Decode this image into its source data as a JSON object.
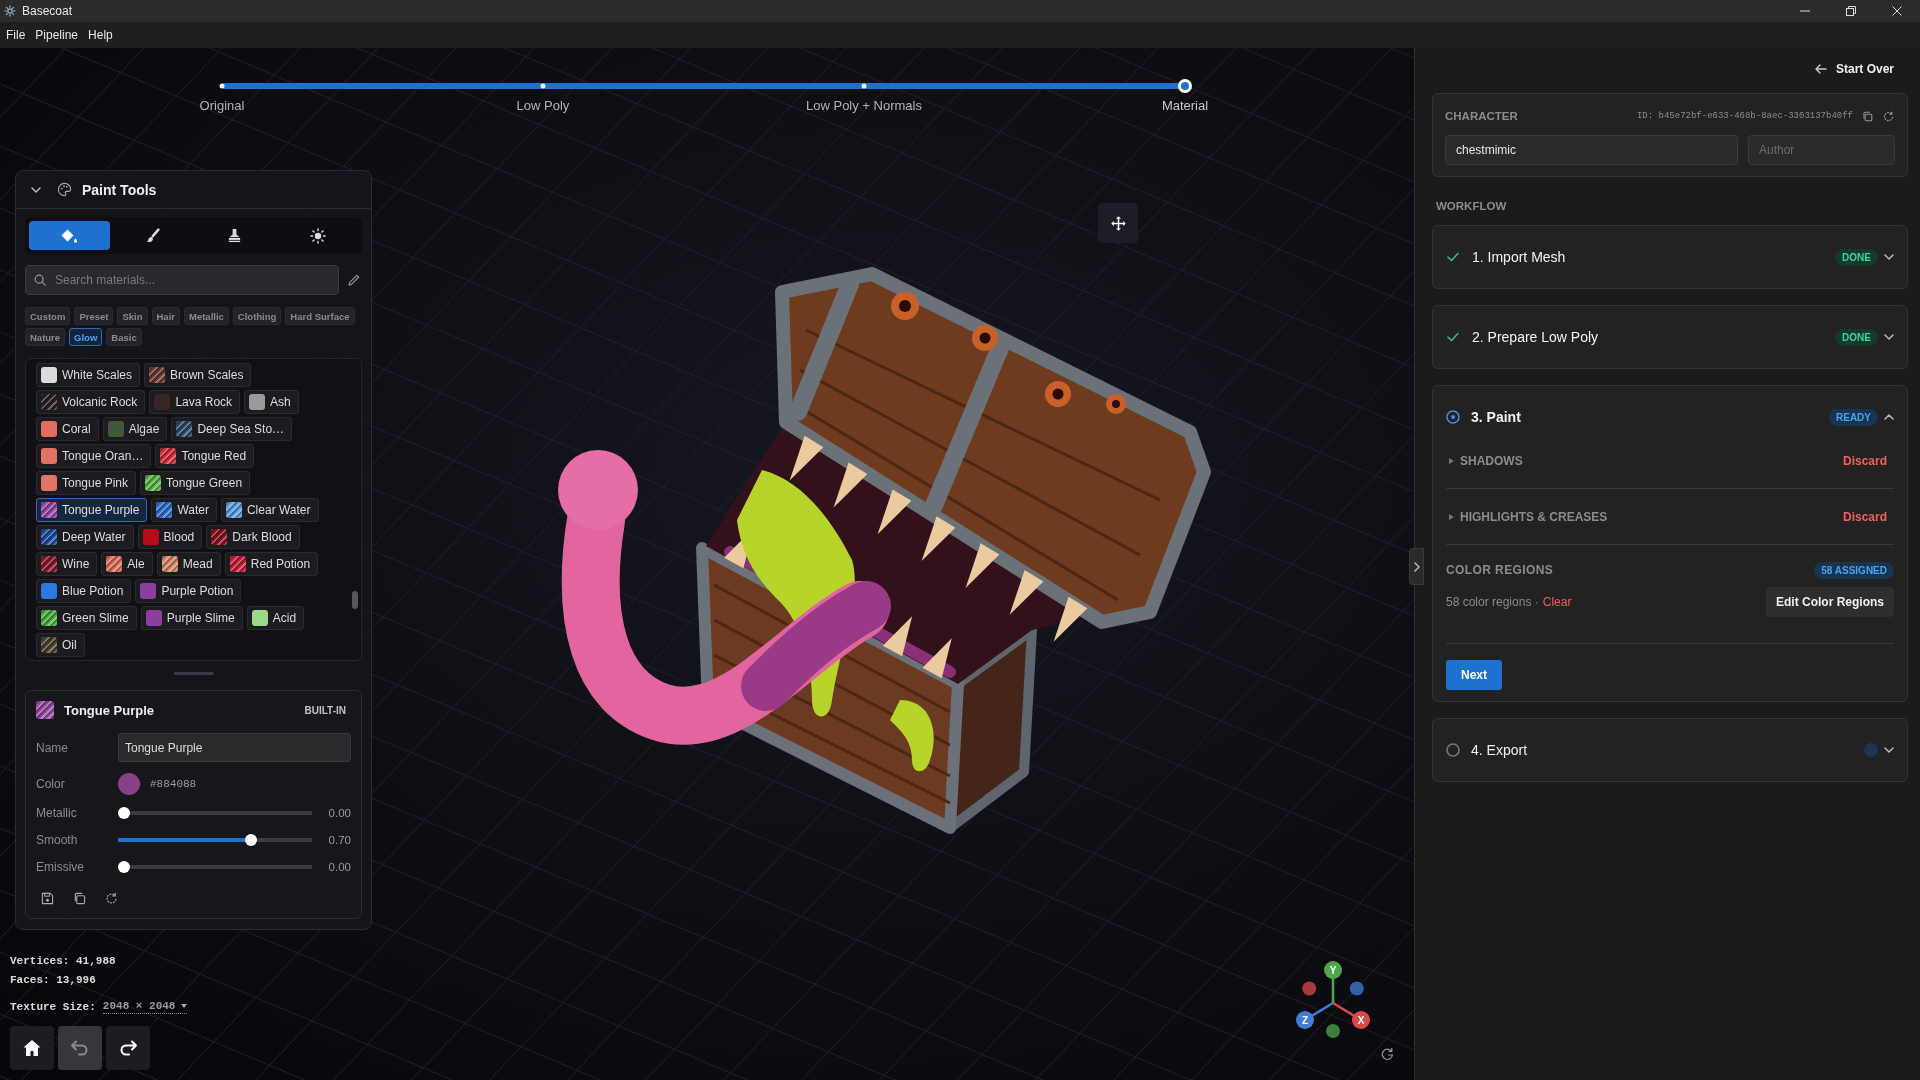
{
  "window": {
    "title": "Basecoat"
  },
  "menu": [
    "File",
    "Pipeline",
    "Help"
  ],
  "pipeline": {
    "level": 1,
    "steps": [
      {
        "label": "Original",
        "selected": false
      },
      {
        "label": "Low Poly",
        "selected": false
      },
      {
        "label": "Low Poly + Normals",
        "selected": false
      },
      {
        "label": "Material",
        "selected": true
      }
    ]
  },
  "paint_tools": {
    "title": "Paint Tools",
    "expanded": true,
    "tools": [
      {
        "kind": "fill",
        "selected": true
      },
      {
        "kind": "brush",
        "selected": false
      },
      {
        "kind": "stamp",
        "selected": false
      },
      {
        "kind": "light",
        "selected": false
      }
    ],
    "search": {
      "placeholder": "Search materials..."
    },
    "categories": [
      {
        "label": "Custom",
        "selected": false
      },
      {
        "label": "Preset",
        "selected": false
      },
      {
        "label": "Skin",
        "selected": false
      },
      {
        "label": "Hair",
        "selected": false
      },
      {
        "label": "Metallic",
        "selected": false
      },
      {
        "label": "Clothing",
        "selected": false
      },
      {
        "label": "Hard Surface",
        "selected": false
      },
      {
        "label": "Nature",
        "selected": false
      },
      {
        "label": "Glow",
        "selected": true
      },
      {
        "label": "Basic",
        "selected": false
      }
    ],
    "materials": [
      {
        "name": "White Scales",
        "color": "#dcdcdc",
        "striped": false,
        "selected": false
      },
      {
        "name": "Brown Scales",
        "color": "#6b3a35",
        "striped": true,
        "selected": false
      },
      {
        "name": "Volcanic Rock",
        "color": "#2e1f1c",
        "striped": true,
        "selected": false
      },
      {
        "name": "Lava Rock",
        "color": "#3a2420",
        "striped": false,
        "selected": false
      },
      {
        "name": "Ash",
        "color": "#9a9a9a",
        "striped": false,
        "selected": false
      },
      {
        "name": "Coral",
        "color": "#e06e62",
        "striped": false,
        "selected": false
      },
      {
        "name": "Algae",
        "color": "#3f5a3a",
        "striped": false,
        "selected": false
      },
      {
        "name": "Deep Sea Sto…",
        "color": "#2f4a6a",
        "striped": true,
        "selected": false
      },
      {
        "name": "Tongue Oran…",
        "color": "#e07262",
        "striped": false,
        "selected": false
      },
      {
        "name": "Tongue Red",
        "color": "#d0303e",
        "striped": true,
        "selected": false
      },
      {
        "name": "Tongue Pink",
        "color": "#e0756a",
        "striped": false,
        "selected": false
      },
      {
        "name": "Tongue Green",
        "color": "#5cb84b",
        "striped": true,
        "selected": false
      },
      {
        "name": "Tongue Purple",
        "color": "#9a4aa8",
        "striped": true,
        "selected": true
      },
      {
        "name": "Water",
        "color": "#2f6fd0",
        "striped": true,
        "selected": false
      },
      {
        "name": "Clear Water",
        "color": "#5aa0ea",
        "striped": true,
        "selected": false
      },
      {
        "name": "Deep Water",
        "color": "#1f4ba0",
        "striped": true,
        "selected": false
      },
      {
        "name": "Blood",
        "color": "#b50d18",
        "striped": false,
        "selected": false
      },
      {
        "name": "Dark Blood",
        "color": "#8b1020",
        "striped": true,
        "selected": false
      },
      {
        "name": "Wine",
        "color": "#8c1830",
        "striped": true,
        "selected": false
      },
      {
        "name": "Ale",
        "color": "#e0735e",
        "striped": true,
        "selected": false
      },
      {
        "name": "Mead",
        "color": "#d98a6c",
        "striped": true,
        "selected": false
      },
      {
        "name": "Red Potion",
        "color": "#c8203a",
        "striped": true,
        "selected": false
      },
      {
        "name": "Blue Potion",
        "color": "#2b79e1",
        "striped": false,
        "selected": false
      },
      {
        "name": "Purple Potion",
        "color": "#8b40a0",
        "striped": false,
        "selected": false
      },
      {
        "name": "Green Slime",
        "color": "#4fb040",
        "striped": true,
        "selected": false
      },
      {
        "name": "Purple Slime",
        "color": "#8b40a0",
        "striped": false,
        "selected": false
      },
      {
        "name": "Acid",
        "color": "#9bd88a",
        "striped": false,
        "selected": false
      },
      {
        "name": "Oil",
        "color": "#4f4232",
        "striped": true,
        "selected": false
      }
    ],
    "details": {
      "title": "Tongue Purple",
      "tag": "BUILT-IN",
      "name_label": "Name",
      "name_value": "Tongue Purple",
      "color_label": "Color",
      "color": "#884088",
      "color_text": "#884088",
      "sliders": [
        {
          "label": "Metallic",
          "level": 0,
          "reading": "0.00"
        },
        {
          "label": "Smooth",
          "level": 0.7,
          "reading": "0.70"
        },
        {
          "label": "Emissive",
          "level": 0,
          "reading": "0.00"
        }
      ]
    }
  },
  "stats": {
    "vertices": "Vertices: 41,988",
    "faces": "Faces: 13,996",
    "texture_label": "Texture Size:",
    "texture_value": "2048 × 2048"
  },
  "view_buttons": [
    {
      "kind": "home",
      "disabled": false
    },
    {
      "kind": "undo",
      "disabled": true
    },
    {
      "kind": "redo",
      "disabled": false
    }
  ],
  "gizmo": {
    "axes": [
      {
        "label": "Y",
        "color": "#4ea84a"
      },
      {
        "label": "Z",
        "color": "#3f7fd8"
      },
      {
        "label": "X",
        "color": "#de4a4a"
      }
    ]
  },
  "sidebar": {
    "start_over": "Start Over",
    "character": {
      "label": "CHARACTER",
      "id": "ID: b45e72bf-e633-468b-8aec-3303137b40ff",
      "name": {
        "value": "chestmimic"
      },
      "author": {
        "placeholder": "Author"
      }
    },
    "workflow": {
      "title": "WORKFLOW",
      "steps": [
        {
          "title": "1. Import Mesh",
          "kind": "done",
          "badge": "DONE",
          "expanded": false
        },
        {
          "title": "2. Prepare Low Poly",
          "kind": "done",
          "badge": "DONE",
          "expanded": false
        },
        {
          "title": "3. Paint",
          "kind": "active",
          "badge": "READY",
          "expanded": true,
          "sections": [
            {
              "title": "SHADOWS",
              "action": "Discard",
              "expanded": false
            },
            {
              "title": "HIGHLIGHTS & CREASES",
              "action": "Discard",
              "expanded": false
            }
          ],
          "color_regions": {
            "title": "COLOR REGIONS",
            "badge": "58 ASSIGNED",
            "summary": "58 color regions ·",
            "link": "Clear",
            "button": "Edit Color Regions"
          },
          "next_button": "Next"
        },
        {
          "title": "4. Export",
          "kind": "pending",
          "expanded": false
        }
      ]
    }
  }
}
